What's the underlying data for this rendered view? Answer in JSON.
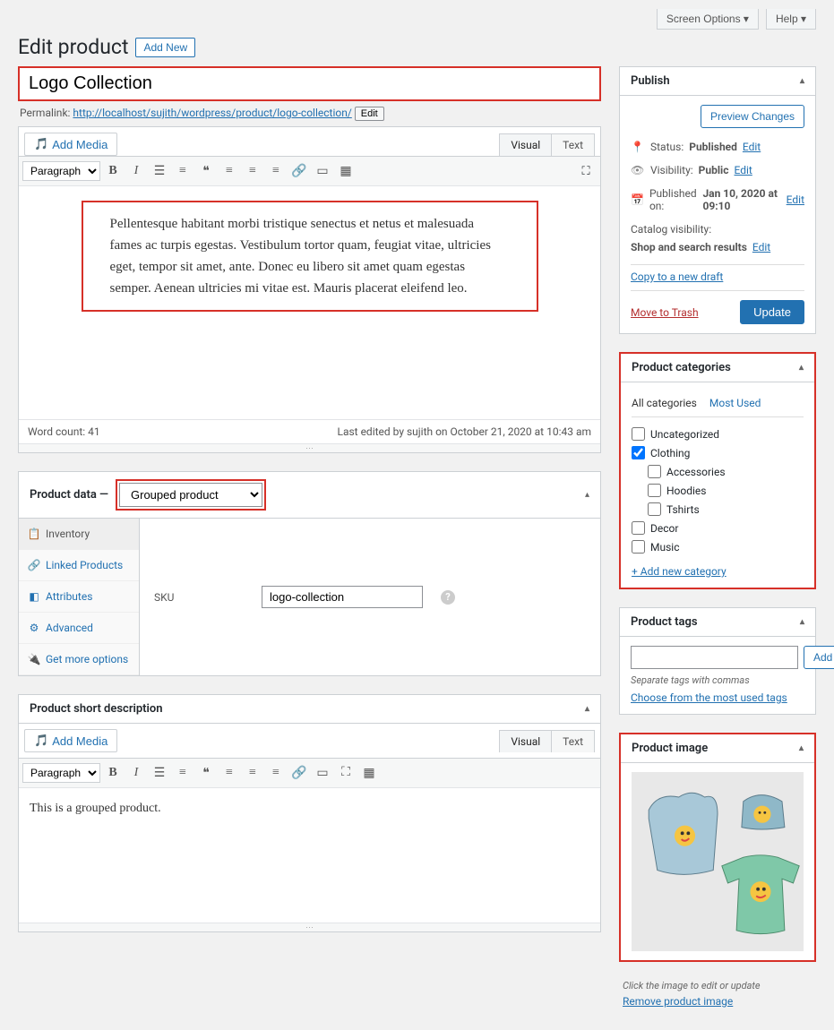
{
  "header": {
    "screen_options": "Screen Options ▾",
    "help": "Help ▾",
    "page_title": "Edit product",
    "add_new": "Add New"
  },
  "title_input": "Logo Collection",
  "permalink": {
    "label": "Permalink:",
    "url_text": "http://localhost/sujith/wordpress/product/logo-collection/",
    "edit": "Edit"
  },
  "editor": {
    "add_media": "Add Media",
    "visual_tab": "Visual",
    "text_tab": "Text",
    "format_select": "Paragraph",
    "content": "Pellentesque habitant morbi tristique senectus et netus et malesuada fames ac turpis egestas. Vestibulum tortor quam, feugiat vitae, ultricies eget, tempor sit amet, ante. Donec eu libero sit amet quam egestas semper. Aenean ultricies mi vitae est. Mauris placerat eleifend leo.",
    "word_count": "Word count: 41",
    "last_edited": "Last edited by sujith on October 21, 2020 at 10:43 am"
  },
  "product_data": {
    "header_label": "Product data —",
    "type_selected": "Grouped product",
    "tabs": {
      "inventory": "Inventory",
      "linked": "Linked Products",
      "attributes": "Attributes",
      "advanced": "Advanced",
      "get_more": "Get more options"
    },
    "sku_label": "SKU",
    "sku_value": "logo-collection"
  },
  "short_desc": {
    "header": "Product short description",
    "add_media": "Add Media",
    "visual_tab": "Visual",
    "text_tab": "Text",
    "format_select": "Paragraph",
    "content": "This is a grouped product."
  },
  "publish": {
    "header": "Publish",
    "preview_btn": "Preview Changes",
    "status_label": "Status:",
    "status_value": "Published",
    "visibility_label": "Visibility:",
    "visibility_value": "Public",
    "published_label": "Published on:",
    "published_value": "Jan 10, 2020 at 09:10",
    "catalog_label": "Catalog visibility:",
    "catalog_value": "Shop and search results",
    "edit_link": "Edit",
    "copy_draft": "Copy to a new draft",
    "trash": "Move to Trash",
    "update_btn": "Update"
  },
  "categories": {
    "header": "Product categories",
    "tab_all": "All categories",
    "tab_most": "Most Used",
    "items": {
      "uncategorized": "Uncategorized",
      "clothing": "Clothing",
      "accessories": "Accessories",
      "hoodies": "Hoodies",
      "tshirts": "Tshirts",
      "decor": "Decor",
      "music": "Music"
    },
    "add_new": "+ Add new category"
  },
  "tags": {
    "header": "Product tags",
    "add_btn": "Add",
    "hint": "Separate tags with commas",
    "choose_link": "Choose from the most used tags"
  },
  "product_image": {
    "header": "Product image",
    "click_hint": "Click the image to edit or update",
    "remove_link": "Remove product image"
  }
}
